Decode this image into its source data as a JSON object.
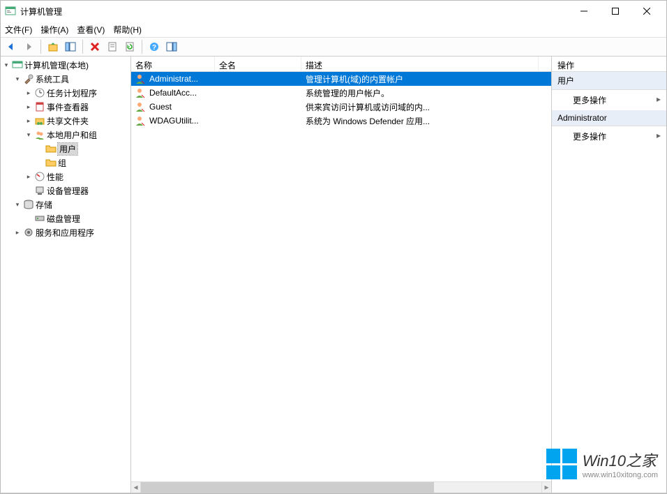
{
  "window": {
    "title": "计算机管理"
  },
  "menubar": {
    "file": "文件(F)",
    "action": "操作(A)",
    "view": "查看(V)",
    "help": "帮助(H)"
  },
  "tree": {
    "root": "计算机管理(本地)",
    "system_tools": "系统工具",
    "task_scheduler": "任务计划程序",
    "event_viewer": "事件查看器",
    "shared_folders": "共享文件夹",
    "local_users": "本地用户和组",
    "users": "用户",
    "groups": "组",
    "performance": "性能",
    "device_manager": "设备管理器",
    "storage": "存储",
    "disk_management": "磁盘管理",
    "services_apps": "服务和应用程序"
  },
  "list": {
    "columns": {
      "name": "名称",
      "fullname": "全名",
      "description": "描述"
    },
    "rows": [
      {
        "name": "Administrat...",
        "fullname": "",
        "description": "管理计算机(域)的内置帐户",
        "selected": true
      },
      {
        "name": "DefaultAcc...",
        "fullname": "",
        "description": "系统管理的用户帐户。",
        "selected": false
      },
      {
        "name": "Guest",
        "fullname": "",
        "description": "供来宾访问计算机或访问域的内...",
        "selected": false
      },
      {
        "name": "WDAGUtilit...",
        "fullname": "",
        "description": "系统为 Windows Defender 应用...",
        "selected": false
      }
    ]
  },
  "actions": {
    "header": "操作",
    "section1": "用户",
    "more1": "更多操作",
    "section2": "Administrator",
    "more2": "更多操作"
  },
  "watermark": {
    "main": "Win10之家",
    "sub": "www.win10xitong.com"
  }
}
